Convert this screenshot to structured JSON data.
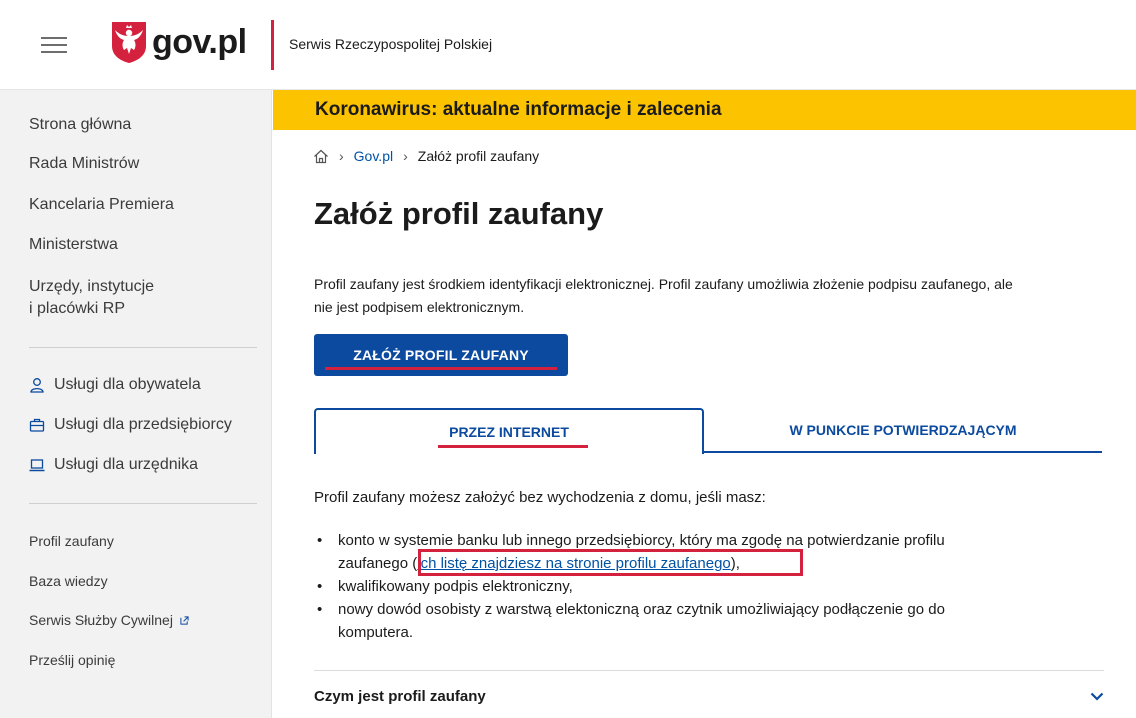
{
  "header": {
    "logo_text": "gov.pl",
    "service_name": "Serwis Rzeczypospolitej Polskiej"
  },
  "sidebar": {
    "main_links": [
      "Strona główna",
      "Rada Ministrów",
      "Kancelaria Premiera",
      "Ministerstwa"
    ],
    "offices_line1": "Urzędy, instytucje",
    "offices_line2": "i placówki RP",
    "services": [
      {
        "label": "Usługi dla obywatela",
        "icon": "person-icon"
      },
      {
        "label": "Usługi dla przedsiębiorcy",
        "icon": "briefcase-icon"
      },
      {
        "label": "Usługi dla urzędnika",
        "icon": "laptop-icon"
      }
    ],
    "small_links": [
      "Profil zaufany",
      "Baza wiedzy",
      "Serwis Służby Cywilnej",
      "Prześlij opinię"
    ]
  },
  "banner": {
    "text": "Koronawirus: aktualne informacje i zalecenia"
  },
  "breadcrumb": {
    "home_icon": "home-icon",
    "items": [
      "Gov.pl",
      "Załóż profil zaufany"
    ]
  },
  "page": {
    "title": "Załóż profil zaufany",
    "intro_line1": "Profil zaufany jest środkiem identyfikacji elektronicznej. Profil zaufany umożliwia złożenie podpisu zaufanego, ale",
    "intro_line2": "nie jest podpisem elektronicznym.",
    "cta_label": "ZAŁÓŻ PROFIL ZAUFANY"
  },
  "tabs": {
    "active": "PRZEZ INTERNET",
    "inactive": "W PUNKCIE POTWIERDZAJĄCYM"
  },
  "content": {
    "lead": "Profil zaufany możesz założyć bez wychodzenia z domu, jeśli masz:",
    "bullet1_line1": "konto w systemie banku lub innego przedsiębiorcy, który ma zgodę na potwierdzanie profilu",
    "bullet1_prefix": "zaufanego ",
    "bullet1_open_paren": "(",
    "bullet1_link": "ich listę znajdziesz na stronie profilu zaufanego",
    "bullet1_suffix": "),",
    "bullet2": "kwalifikowany podpis elektroniczny,",
    "bullet3_line1": "nowy dowód osobisty z warstwą elektoniczną oraz czytnik umożliwiający podłączenie go do",
    "bullet3_line2": "komputera."
  },
  "accordion": {
    "title": "Czym jest profil zaufany",
    "icon": "chevron-down-icon"
  },
  "colors": {
    "brand_blue": "#0b4a9e",
    "banner_yellow": "#fcc300",
    "accent_red": "#d4213d"
  }
}
